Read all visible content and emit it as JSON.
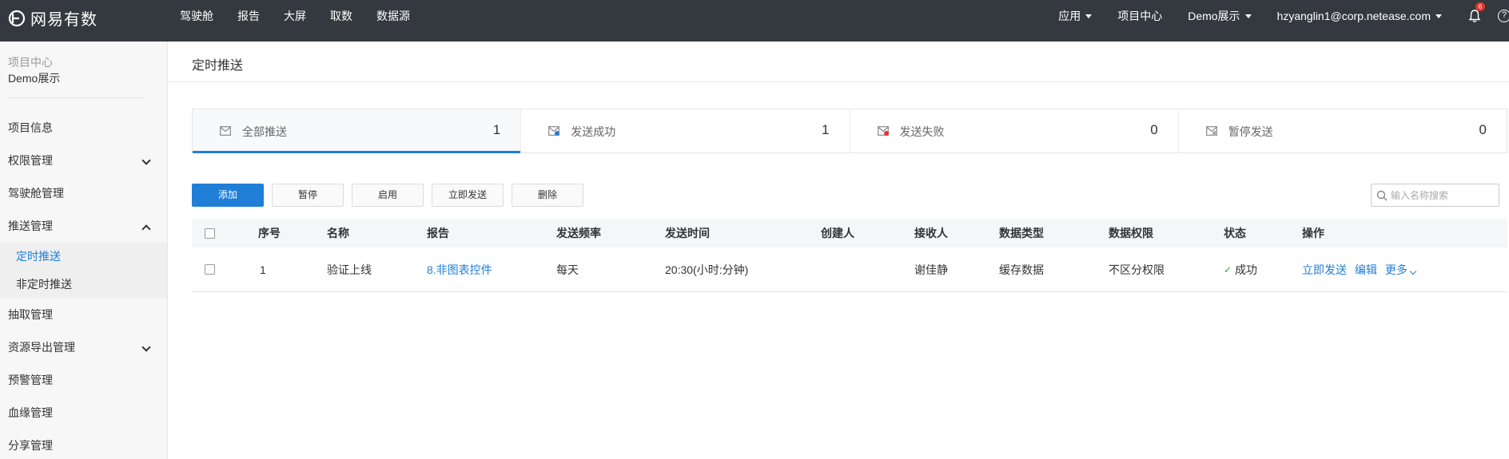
{
  "app": {
    "logo_text": "网易有数"
  },
  "topnav": {
    "items": [
      "驾驶舱",
      "报告",
      "大屏",
      "取数",
      "数据源"
    ]
  },
  "topright": {
    "apps_label": "应用",
    "project_center_label": "项目中心",
    "project_label": "Demo展示",
    "user_email": "hzyanglin1@corp.netease.com",
    "notification_count": "6",
    "help_glyph": "?"
  },
  "sidebar": {
    "project_center_label": "项目中心",
    "project_name": "Demo展示",
    "items": [
      {
        "label": "项目信息"
      },
      {
        "label": "权限管理"
      },
      {
        "label": "驾驶舱管理"
      },
      {
        "label": "推送管理"
      },
      {
        "label": "定时推送"
      },
      {
        "label": "非定时推送"
      },
      {
        "label": "抽取管理"
      },
      {
        "label": "资源导出管理"
      },
      {
        "label": "预警管理"
      },
      {
        "label": "血缘管理"
      },
      {
        "label": "分享管理"
      }
    ]
  },
  "main": {
    "page_title": "定时推送",
    "stats": [
      {
        "label": "全部推送",
        "count": "1",
        "icon": "mail-icon"
      },
      {
        "label": "发送成功",
        "count": "1",
        "icon": "mail-success-icon"
      },
      {
        "label": "发送失败",
        "count": "0",
        "icon": "mail-fail-icon"
      },
      {
        "label": "暂停发送",
        "count": "0",
        "icon": "mail-paused-icon"
      }
    ],
    "toolbar": {
      "add_label": "添加",
      "pause_label": "暂停",
      "enable_label": "启用",
      "send_now_label": "立即发送",
      "delete_label": "删除"
    },
    "search": {
      "placeholder": "输入名称搜索"
    },
    "table": {
      "columns": [
        "序号",
        "名称",
        "报告",
        "发送频率",
        "发送时间",
        "创建人",
        "接收人",
        "数据类型",
        "数据权限",
        "状态",
        "操作"
      ],
      "rows": [
        {
          "index": "1",
          "name": "验证上线",
          "report": "8.非图表控件",
          "frequency": "每天",
          "send_time": "20:30(小时:分钟)",
          "creator": "",
          "receiver": "谢佳静",
          "data_type": "缓存数据",
          "data_permission": "不区分权限",
          "status": "成功",
          "actions": {
            "send_now": "立即发送",
            "edit": "编辑",
            "more": "更多"
          }
        }
      ]
    }
  },
  "colors": {
    "topbar_bg": "#33393e",
    "accent": "#1f7ed6",
    "success": "#2aa844",
    "badge": "#e5352b"
  }
}
